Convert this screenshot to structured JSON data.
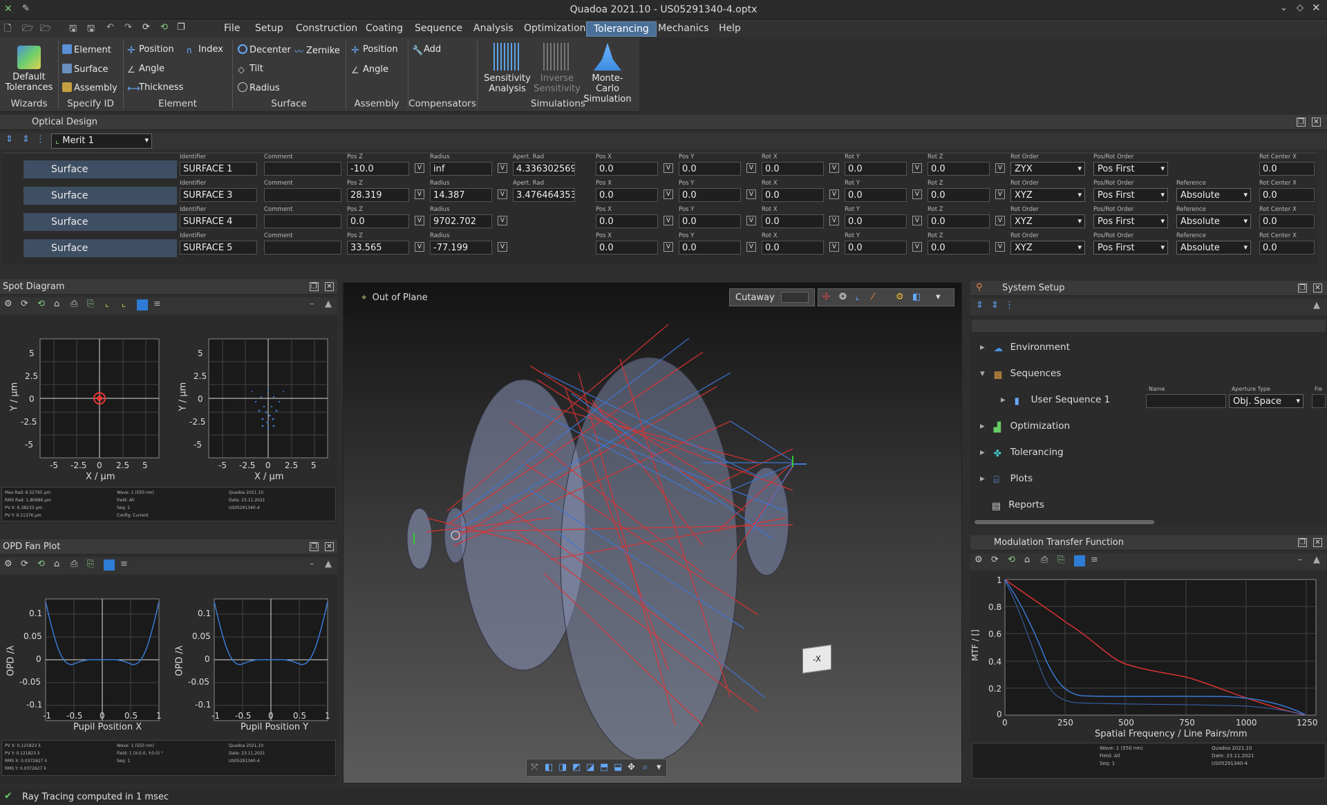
{
  "window": {
    "title": "Quadoa 2021.10 - US05291340-4.optx"
  },
  "menu": [
    "File",
    "Setup",
    "Construction",
    "Coating",
    "Sequence",
    "Analysis",
    "Optimization",
    "Tolerancing",
    "Mechanics",
    "Help"
  ],
  "menu_active": "Tolerancing",
  "ribbon": {
    "wizards": {
      "label": "Default Tolerances",
      "group": "Wizards"
    },
    "specify_id": {
      "items": [
        "Element",
        "Surface",
        "Assembly"
      ],
      "group": "Specify ID"
    },
    "element": {
      "items": [
        "Position",
        "Index",
        "Angle",
        "Thickness"
      ],
      "group": "Element"
    },
    "surface": {
      "items": [
        "Decenter",
        "Zernike",
        "Tilt",
        "Radius"
      ],
      "group": "Surface"
    },
    "assembly": {
      "items": [
        "Position",
        "Angle"
      ],
      "group": "Assembly"
    },
    "compensators": {
      "items": [
        "Add"
      ],
      "group": "Compensators"
    },
    "simulations": {
      "items": [
        "Sensitivity Analysis",
        "Inverse Sensitivity",
        "Monte-Carlo Simulation"
      ],
      "group": "Simulations"
    }
  },
  "optical_design": {
    "title": "Optical Design",
    "merit": "Merit 1",
    "rows": [
      {
        "type": "Surface",
        "identifier": "SURFACE 1",
        "pos_z": "-10.0",
        "radius": "inf",
        "apert_rad": "4.336302569",
        "pos_x": "0.0",
        "pos_y": "0.0",
        "rot_x": "0.0",
        "rot_y": "0.0",
        "rot_z": "0.0",
        "rot_order": "ZYX",
        "pos_rot_order": "Pos First",
        "reference": "",
        "rot_center_x": "0.0"
      },
      {
        "type": "Surface",
        "identifier": "SURFACE 3",
        "pos_z": "28.319",
        "radius": "14.387",
        "apert_rad": "3.476464353",
        "pos_x": "0.0",
        "pos_y": "0.0",
        "rot_x": "0.0",
        "rot_y": "0.0",
        "rot_z": "0.0",
        "rot_order": "XYZ",
        "pos_rot_order": "Pos First",
        "reference": "Absolute",
        "rot_center_x": "0.0"
      },
      {
        "type": "Surface",
        "identifier": "SURFACE 4",
        "pos_z": "0.0",
        "radius": "9702.702",
        "apert_rad": "",
        "pos_x": "0.0",
        "pos_y": "0.0",
        "rot_x": "0.0",
        "rot_y": "0.0",
        "rot_z": "0.0",
        "rot_order": "XYZ",
        "pos_rot_order": "Pos First",
        "reference": "Absolute",
        "rot_center_x": "0.0"
      },
      {
        "type": "Surface",
        "identifier": "SURFACE 5",
        "pos_z": "33.565",
        "radius": "-77.199",
        "apert_rad": "",
        "pos_x": "0.0",
        "pos_y": "0.0",
        "rot_x": "0.0",
        "rot_y": "0.0",
        "rot_z": "0.0",
        "rot_order": "XYZ",
        "pos_rot_order": "Pos First",
        "reference": "Absolute",
        "rot_center_x": "0.0"
      }
    ],
    "col_labels": {
      "identifier": "Identifier",
      "comment": "Comment",
      "pos_z": "Pos Z",
      "radius": "Radius",
      "apert_rad": "Apert. Rad",
      "pos_x": "Pos X",
      "pos_y": "Pos Y",
      "rot_x": "Rot X",
      "rot_y": "Rot Y",
      "rot_z": "Rot Z",
      "rot_order": "Rot Order",
      "pos_rot_order": "Pos/Rot Order",
      "reference": "Reference",
      "rot_center_x": "Rot Center X"
    }
  },
  "spot": {
    "title": "Spot Diagram",
    "xlabel": "X / µm",
    "ylabel": "Y / µm",
    "ticks": [
      "5",
      "2.5",
      "0",
      "-2.5",
      "-5"
    ],
    "xticks": [
      "-5",
      "-2.5",
      "0",
      "2.5",
      "5"
    ],
    "info_left": [
      "Max Rad: 6.52765 µm",
      "RMS Rad: 1.80986 µm",
      "PV X: 6.38233 µm",
      "PV Y: 9.11376 µm"
    ],
    "info_mid": [
      "Wave: 1 (550 nm)",
      "Field: All",
      "Seq: 1",
      "Config: Current"
    ],
    "info_right": [
      "Quadoa 2021.10",
      "Date: 23.11.2021",
      "US05291340-4"
    ]
  },
  "opd": {
    "title": "OPD Fan Plot",
    "xlabel1": "Pupil Position X",
    "xlabel2": "Pupil Position Y",
    "ylabel": "OPD /λ",
    "yticks": [
      "0.1",
      "0.05",
      "0",
      "-0.05",
      "-0.1"
    ],
    "xticks": [
      "-1",
      "-0.5",
      "0",
      "0.5",
      "1"
    ],
    "info_left": [
      "PV X: 0.121823 λ",
      "PV Y: 0.121823 λ",
      "RMS X: 0.0372627 λ",
      "RMS Y: 0.0372627 λ"
    ],
    "info_mid": [
      "Wave: 1 (550 nm)",
      "Field: 1 (X:0.0, Y:0.0) °",
      "Seq: 1"
    ],
    "info_right": [
      "Quadoa 2021.10",
      "Date: 23.11.2021",
      "US05291340-4"
    ]
  },
  "viewport": {
    "label": "Out of Plane",
    "cutaway": "Cutaway",
    "cube": "-X"
  },
  "system_setup": {
    "title": "System Setup",
    "items": [
      "Environment",
      "Sequences",
      "User Sequence 1",
      "Optimization",
      "Tolerancing",
      "Plots",
      "Reports"
    ],
    "name_label": "Name",
    "aperture_label": "Aperture Type",
    "aperture_value": "Obj. Space",
    "fie_label": "Fie"
  },
  "mtf": {
    "title": "Modulation Transfer Function",
    "xlabel": "Spatial Frequency / Line Pairs/mm",
    "ylabel": "MTF / []",
    "yticks": [
      "1",
      "0.8",
      "0.6",
      "0.4",
      "0.2",
      "0"
    ],
    "xticks": [
      "0",
      "250",
      "500",
      "750",
      "1000",
      "1250"
    ],
    "info_mid": [
      "Wave: 1 (550 nm)",
      "Field: All",
      "Seq: 1"
    ],
    "info_right": [
      "Quadoa 2021.10",
      "Date: 23.11.2021",
      "US05291340-4"
    ]
  },
  "status": "Ray Tracing computed in 1 msec"
}
